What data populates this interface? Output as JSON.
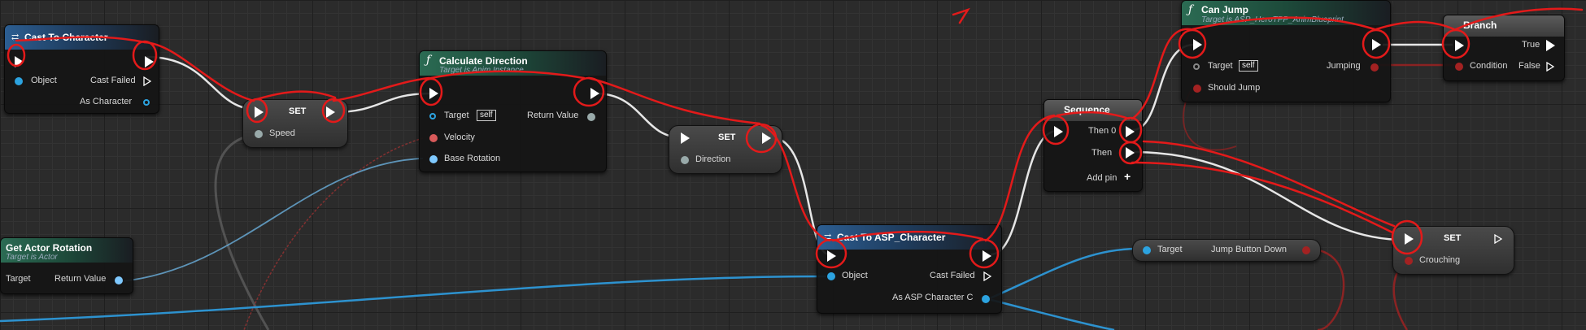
{
  "colors": {
    "exec": "#ffffff",
    "object_pin": "#2ca3e0",
    "struct_pin": "#7fc9ff",
    "bool_pin": "#a32222",
    "float_pin": "#9fd86b",
    "annotation": "#e31a1a"
  },
  "nodes": {
    "cast_character": {
      "title": "Cast To Character",
      "object": "Object",
      "cast_failed": "Cast Failed",
      "as_character": "As Character"
    },
    "set_speed": {
      "title": "SET",
      "speed": "Speed"
    },
    "calc_direction": {
      "icon": "ƒ",
      "title": "Calculate Direction",
      "subtitle": "Target is Anim Instance",
      "target": "Target",
      "self": "self",
      "velocity": "Velocity",
      "base_rotation": "Base Rotation",
      "return_value": "Return Value"
    },
    "set_direction": {
      "title": "SET",
      "direction": "Direction"
    },
    "get_actor_rotation": {
      "title": "Get Actor Rotation",
      "subtitle": "Target is Actor",
      "target": "Target",
      "return_value": "Return Value"
    },
    "cast_asp": {
      "title": "Cast To ASP_Character",
      "object": "Object",
      "cast_failed": "Cast Failed",
      "as_asp": "As ASP Character C"
    },
    "sequence": {
      "title": "Sequence",
      "then0": "Then 0",
      "then1": "Then",
      "add_pin": "Add pin"
    },
    "can_jump": {
      "icon": "ƒ",
      "title": "Can Jump",
      "subtitle": "Target is ASP_HeroTPP_AnimBlueprint",
      "target": "Target",
      "self": "self",
      "should_jump": "Should Jump",
      "jumping": "Jumping"
    },
    "branch": {
      "title": "Branch",
      "condition": "Condition",
      "true_label": "True",
      "false_label": "False"
    },
    "jump_button": {
      "target": "Target",
      "label": "Jump Button Down"
    },
    "set_crouching": {
      "title": "SET",
      "crouching": "Crouching"
    }
  }
}
